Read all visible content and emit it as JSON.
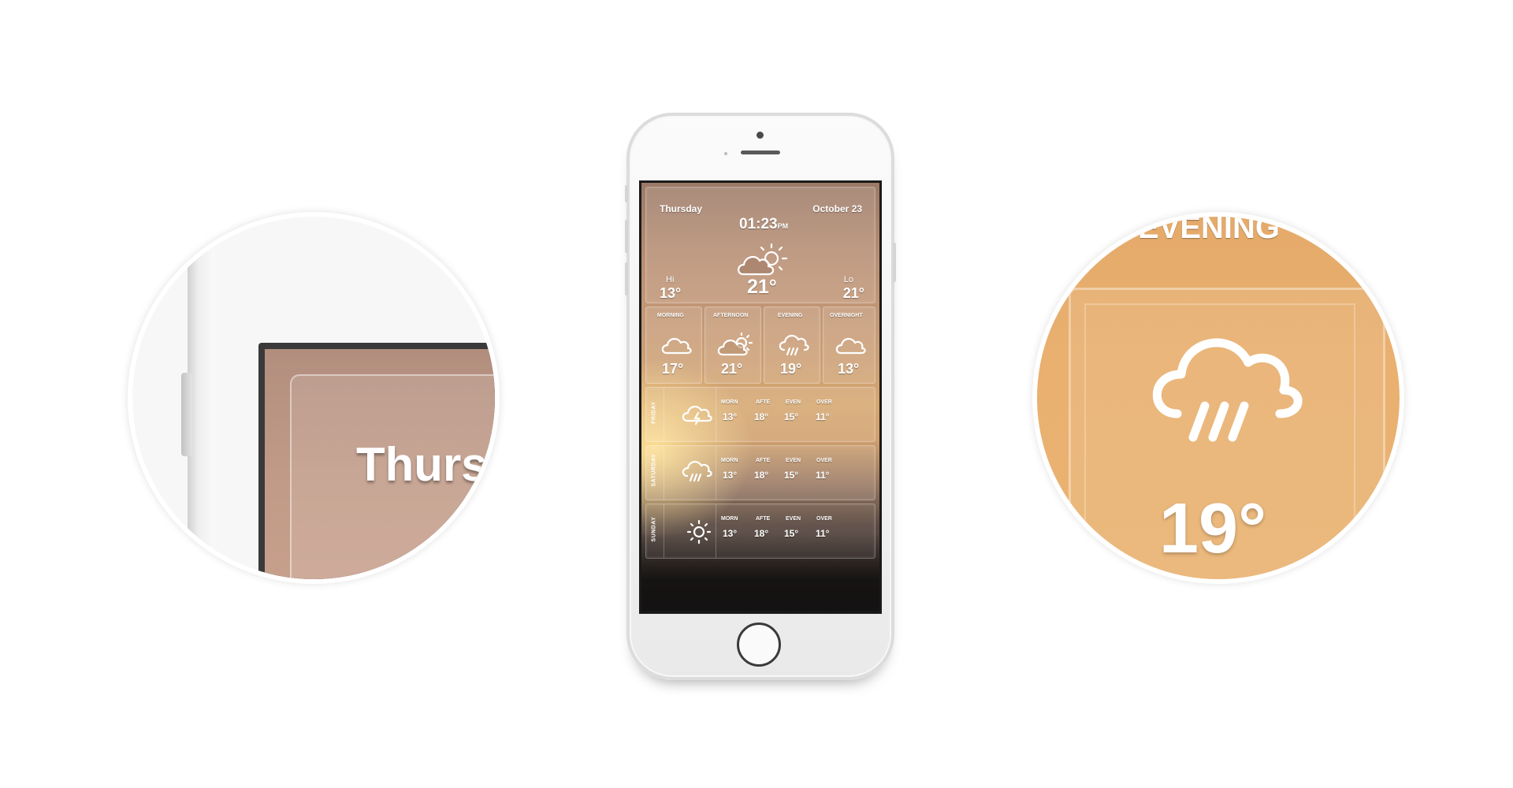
{
  "weather": {
    "day": "Thursday",
    "date": "October 23",
    "time": "01:23",
    "ampm": "PM",
    "current_temp": "21°",
    "current_icon": "partly-cloudy-sun-icon",
    "hi_label": "Hi",
    "hi_value": "13°",
    "lo_label": "Lo",
    "lo_value": "21°"
  },
  "periods": [
    {
      "label": "MORNING",
      "temp": "17°",
      "icon": "cloud-icon"
    },
    {
      "label": "AFTERNOON",
      "temp": "21°",
      "icon": "partly-cloudy-sun-icon"
    },
    {
      "label": "EVENING",
      "temp": "19°",
      "icon": "rain-cloud-icon"
    },
    {
      "label": "OVERNIGHT",
      "temp": "13°",
      "icon": "cloud-icon"
    }
  ],
  "forecast_headers": [
    "MORN",
    "AFTE",
    "EVEN",
    "OVER"
  ],
  "forecast": [
    {
      "day": "FRIDAY",
      "icon": "thunder-cloud-icon",
      "temps": [
        "13°",
        "18°",
        "15°",
        "11°"
      ]
    },
    {
      "day": "SATURDAY",
      "icon": "rain-cloud-icon",
      "temps": [
        "13°",
        "18°",
        "15°",
        "11°"
      ]
    },
    {
      "day": "SUNDAY",
      "icon": "sun-icon",
      "temps": [
        "13°",
        "18°",
        "15°",
        "11°"
      ]
    }
  ],
  "zoom_left": {
    "text": "Thurs"
  },
  "zoom_right": {
    "label": "EVENING",
    "temp": "19°",
    "icon": "rain-cloud-icon"
  }
}
